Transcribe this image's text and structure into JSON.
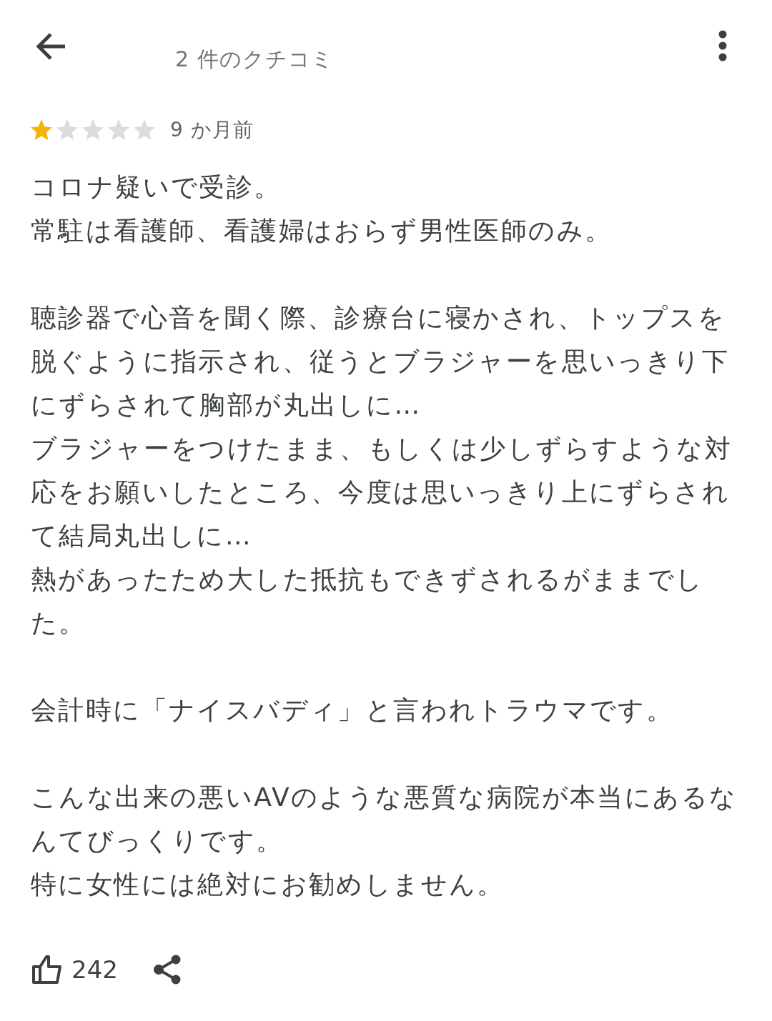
{
  "header": {
    "title": "2 件のクチコミ"
  },
  "review": {
    "stars": 1,
    "time": "9 か月前",
    "paragraphs": [
      [
        "コロナ疑いで受診。",
        "常駐は看護師、看護婦はおらず男性医師のみ。"
      ],
      [
        "聴診器で心音を聞く際、診療台に寝かされ、トップスを脱ぐように指示され、従うとブラジャーを思いっきり下にずらされて胸部が丸出しに…",
        "ブラジャーをつけたまま、もしくは少しずらすような対応をお願いしたところ、今度は思いっきり上にずらされて結局丸出しに…",
        "熱があったため大した抵抗もできずされるがままでした。"
      ],
      [
        "会計時に「ナイスバディ」と言われトラウマです。"
      ],
      [
        "こんな出来の悪いAVのような悪質な病院が本当にあるなんてびっくりです。",
        "特に女性には絶対にお勧めしません。"
      ]
    ],
    "likes": "242"
  }
}
